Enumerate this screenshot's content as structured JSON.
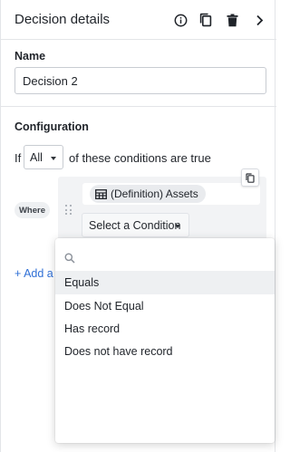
{
  "header": {
    "title": "Decision details",
    "icons": [
      "info-icon",
      "copy-icon",
      "trash-icon",
      "chevron-right-icon"
    ]
  },
  "name_section": {
    "label": "Name",
    "value": "Decision 2"
  },
  "configuration": {
    "label": "Configuration",
    "if_text": "If",
    "all_value": "All",
    "suffix_text": "of these conditions are true",
    "where_badge": "Where",
    "asset_pill": "(Definition) Assets",
    "select_condition": "Select a Condition",
    "add_link": "+ Add a c"
  },
  "dropdown": {
    "search_placeholder": "",
    "items": [
      {
        "label": "Equals",
        "active": true
      },
      {
        "label": "Does Not Equal",
        "active": false
      },
      {
        "label": "Has record",
        "active": false
      },
      {
        "label": "Does not have record",
        "active": false
      }
    ]
  }
}
